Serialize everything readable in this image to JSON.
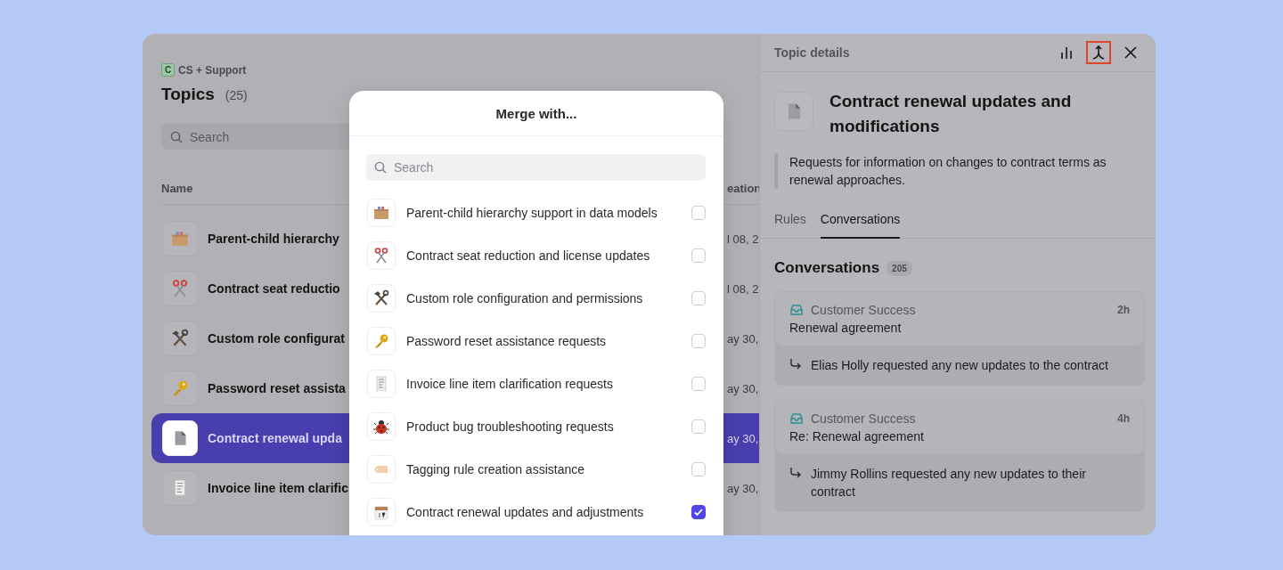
{
  "workspace": {
    "badge": "C",
    "name": "CS + Support"
  },
  "topics": {
    "title": "Topics",
    "count": "(25)",
    "search": {
      "placeholder": "Search"
    },
    "columns": [
      "Name",
      "eation"
    ],
    "rows": [
      {
        "name": "Parent-child hierarchy",
        "date": "l 08, 2",
        "selected": false
      },
      {
        "name": "Contract seat reductio",
        "date": "l 08, 2",
        "selected": false
      },
      {
        "name": "Custom role configurat",
        "date": "ay 30,",
        "selected": false
      },
      {
        "name": "Password reset assista",
        "date": "ay 30,",
        "selected": false
      },
      {
        "name": "Contract renewal upda",
        "date": "ay 30,",
        "selected": true
      },
      {
        "name": "Invoice line item clarific",
        "date": "ay 30,",
        "selected": false
      }
    ]
  },
  "merge_dialog": {
    "title": "Merge with...",
    "search": {
      "placeholder": "Search"
    },
    "items": [
      {
        "label": "Parent-child hierarchy support in data models",
        "checked": false
      },
      {
        "label": "Contract seat reduction and license updates",
        "checked": false
      },
      {
        "label": "Custom role configuration and permissions",
        "checked": false
      },
      {
        "label": "Password reset assistance requests",
        "checked": false
      },
      {
        "label": "Invoice line item clarification requests",
        "checked": false
      },
      {
        "label": "Product bug troubleshooting requests",
        "checked": false
      },
      {
        "label": "Tagging rule creation assistance",
        "checked": false
      },
      {
        "label": "Contract renewal updates and adjustments",
        "checked": true
      }
    ]
  },
  "topic_details": {
    "title": "Topic details",
    "actions": [
      {
        "kind": "chart",
        "highlighted": false
      },
      {
        "kind": "merge",
        "highlighted": true
      },
      {
        "kind": "close",
        "highlighted": false
      }
    ],
    "name": "Contract renewal updates and modifications",
    "description": "Requests for information on changes to contract terms as renewal approaches.",
    "tabs": [
      {
        "label": "Rules",
        "selected": false
      },
      {
        "label": "Conversations",
        "selected": true
      }
    ],
    "conversations_heading": "Conversations",
    "conversations_count": "205",
    "conversations": [
      {
        "source": "Customer Success",
        "time": "2h",
        "subject": "Renewal agreement",
        "reply": "Elias Holly requested any new updates to the contract"
      },
      {
        "source": "Customer Success",
        "time": "4h",
        "subject": "Re: Renewal agreement",
        "reply": "Jimmy Rollins requested any new updates to their contract"
      }
    ]
  }
}
